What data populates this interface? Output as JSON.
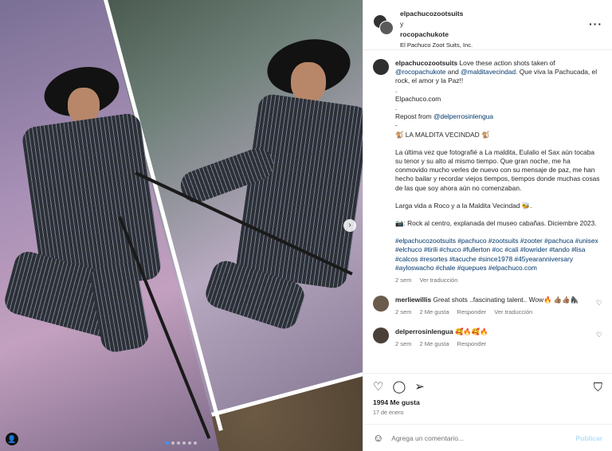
{
  "header": {
    "user1": "elpachucozootsuits",
    "joiner": "y",
    "user2": "rocopachukote",
    "subtitle": "El Pachuco Zoot Suits, Inc.",
    "more_icon": "more-horizontal-icon"
  },
  "caption": {
    "username": "elpachucozootsuits",
    "line1": "Love these action shots taken of",
    "mention1": "@rocopachukote",
    "and": "and",
    "mention2": "@malditavecindad",
    "line1_end": ". Que viva la Pachucada, el rock, el amor y la Paz!!",
    "dot1": ".",
    "site": "Elpachuco.com",
    "dot2": ".",
    "repost": "Repost from",
    "repost_user": "@delperrosinlengua",
    "dash": "-",
    "title": "🐒 LA MALDITA VECINDAD 🐒",
    "para1": "La última vez que fotografié a La maldita, Eulalio el Sax aún tocaba su tenor y su alto al mismo tiempo. Que gran noche, me ha conmovido mucho verles de nuevo con su mensaje de paz, me han hecho bailar y recordar viejos tiempos, tiempos donde muchas cosas de las que soy ahora aún no comenzaban.",
    "para2": "Larga vida a Roco y a la Maldita Vecindad 🐝.",
    "para3": "📷: Rock al centro, explanada del museo cabañas. Diciembre 2023.",
    "hashtags": "#elpachucozootsuits #pachuco #zootsuits #zooter #pachuca #unisex #elchuco #tirili #chuco #fullerton #oc #cali #lowrider #tando #lisa #calcos #resortes #tacuche #since1978 #45yearanniversary #ayloswacho #chale #quepues #elpachuco.com",
    "time": "2 sem",
    "translate": "Ver traducción"
  },
  "comments": [
    {
      "username": "merliewillis",
      "text": "Great shots ..fascinating talent.. Wow🔥 👍🏽👍🏽🦍",
      "time": "2 sem",
      "likes": "2 Me gusta",
      "reply": "Responder",
      "translate": "Ver traducción"
    },
    {
      "username": "delperrosinlengua",
      "text": "🥰🔥🥰🔥",
      "time": "2 sem",
      "likes": "2 Me gusta",
      "reply": "Responder"
    }
  ],
  "actions": {
    "like_icon": "heart-icon",
    "comment_icon": "comment-icon",
    "share_icon": "send-icon",
    "save_icon": "bookmark-icon",
    "likes": "1994 Me gusta",
    "date": "17 de enero"
  },
  "add_comment": {
    "placeholder": "Agrega un comentario...",
    "publish": "Publicar"
  },
  "carousel": {
    "current": 1,
    "total": 6
  },
  "colors": {
    "link": "#00376b",
    "muted": "#737373",
    "publish_disabled": "#b2dffc",
    "dot_active": "#3a96ff"
  }
}
